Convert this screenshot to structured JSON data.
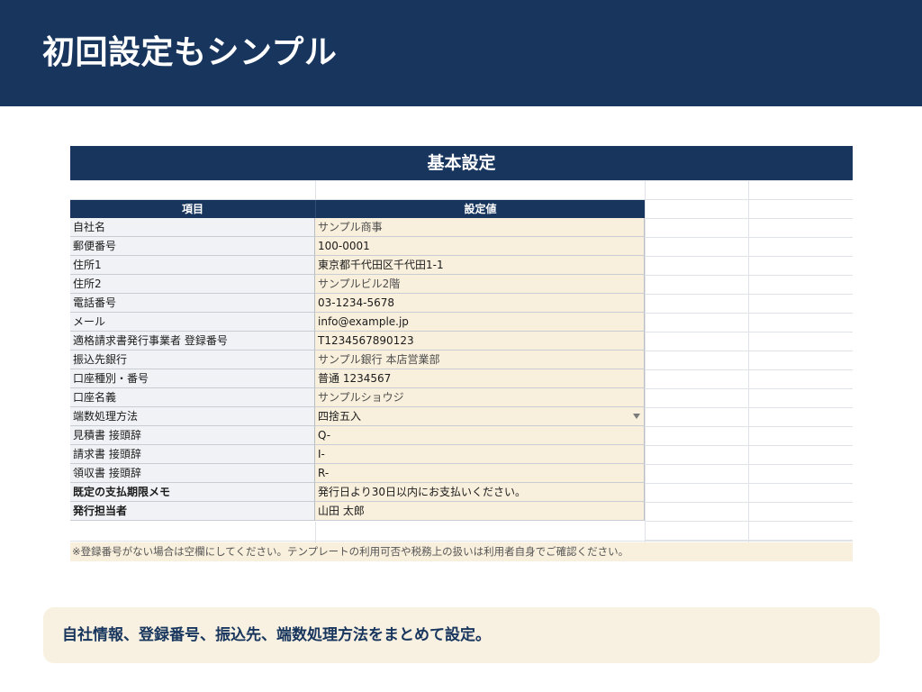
{
  "slide": {
    "heading": "初回設定もシンプル",
    "callout": "自社情報、登録番号、振込先、端数処理方法をまとめて設定。"
  },
  "sheet": {
    "title": "基本設定",
    "headers": {
      "item": "項目",
      "value": "設定値"
    },
    "rows": [
      {
        "label": "自社名",
        "value": "サンプル商事"
      },
      {
        "label": "郵便番号",
        "value": "100-0001"
      },
      {
        "label": "住所1",
        "value": "東京都千代田区千代田1-1"
      },
      {
        "label": "住所2",
        "value": "サンプルビル2階"
      },
      {
        "label": "電話番号",
        "value": "03-1234-5678"
      },
      {
        "label": "メール",
        "value": "info@example.jp"
      },
      {
        "label": "適格請求書発行事業者 登録番号",
        "value": "T1234567890123"
      },
      {
        "label": "振込先銀行",
        "value": "サンプル銀行 本店営業部"
      },
      {
        "label": "口座種別・番号",
        "value": "普通 1234567"
      },
      {
        "label": "口座名義",
        "value": "サンプルショウジ"
      },
      {
        "label": "端数処理方法",
        "value": "四捨五入"
      },
      {
        "label": "見積書 接頭辞",
        "value": "Q-"
      },
      {
        "label": "請求書 接頭辞",
        "value": "I-"
      },
      {
        "label": "領収書 接頭辞",
        "value": "R-"
      },
      {
        "label": "既定の支払期限メモ",
        "value": "発行日より30日以内にお支払いください。"
      },
      {
        "label": "発行担当者",
        "value": "山田 太郎"
      }
    ],
    "note": "※登録番号がない場合は空欄にしてください。テンプレートの利用可否や税務上の扱いは利用者自身でご確認ください。"
  },
  "colors": {
    "navy": "#17355d",
    "input_fill": "#f8efdc",
    "label_fill": "#f1f2f6"
  },
  "icons": {
    "dropdown": "chevron-down-icon"
  }
}
